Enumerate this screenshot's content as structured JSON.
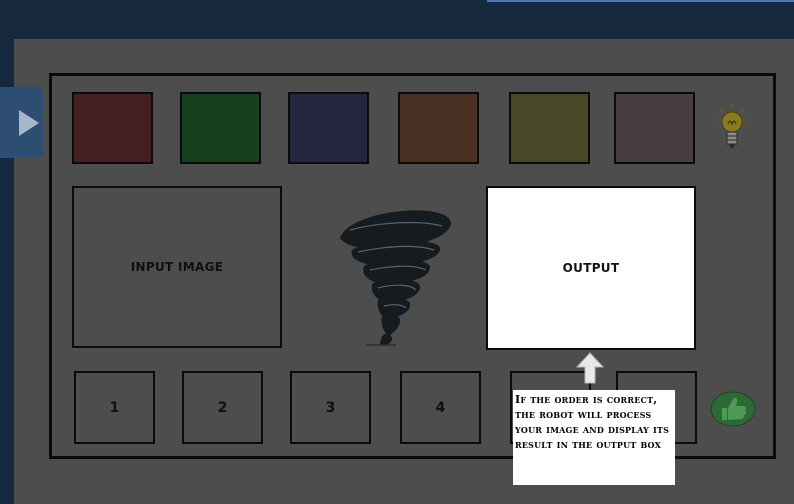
{
  "sidebar": {
    "toggle_icon": "play-arrow-icon"
  },
  "palette": {
    "swatches": [
      {
        "name": "red",
        "color": "#461f23"
      },
      {
        "name": "green",
        "color": "#17401f"
      },
      {
        "name": "blue",
        "color": "#25253f"
      },
      {
        "name": "brown",
        "color": "#4a3124"
      },
      {
        "name": "olive",
        "color": "#4a482a"
      },
      {
        "name": "mauve",
        "color": "#4a3d40"
      }
    ],
    "hint_icon": "lightbulb-icon"
  },
  "workspace": {
    "input_label": "INPUT IMAGE",
    "processor_icon": "tornado-icon",
    "output_label": "OUTPUT"
  },
  "steps": {
    "slots": [
      "1",
      "2",
      "3",
      "4",
      "",
      ""
    ]
  },
  "tooltip": {
    "text": "If the order is correct, the robot will process your image and display its result in the output box",
    "pointer_icon": "up-arrow-icon"
  },
  "submit": {
    "icon": "thumbs-up-icon",
    "color": "#2c6a35"
  }
}
